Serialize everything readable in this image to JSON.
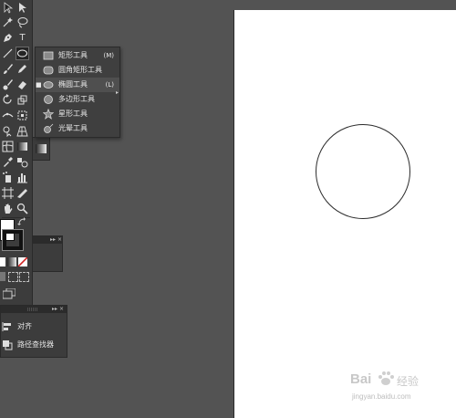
{
  "flyout": {
    "items": [
      {
        "label": "矩形工具",
        "shortcut": "(M)",
        "icon": "rectangle-icon"
      },
      {
        "label": "圆角矩形工具",
        "shortcut": "",
        "icon": "rounded-rectangle-icon"
      },
      {
        "label": "椭圆工具",
        "shortcut": "(L)",
        "icon": "ellipse-icon",
        "selected": true,
        "check": "■"
      },
      {
        "label": "多边形工具",
        "shortcut": "",
        "icon": "polygon-icon"
      },
      {
        "label": "星形工具",
        "shortcut": "",
        "icon": "star-icon"
      },
      {
        "label": "光晕工具",
        "shortcut": "",
        "icon": "flare-icon"
      }
    ],
    "expand_arrow": "▸"
  },
  "minipanel": {
    "controls": "▸▸ ×"
  },
  "align_panel": {
    "controls": "▸▸ ×",
    "items": [
      {
        "label": "对齐",
        "icon": "align-icon"
      },
      {
        "label": "路径查找器",
        "icon": "pathfinder-icon"
      }
    ]
  },
  "toolbar": {
    "type_tool_glyph": "T"
  },
  "watermark": {
    "brand_text": "Bai",
    "brand_suffix": "经验",
    "url": "jingyan.baidu.com"
  },
  "colors": {
    "workspace": "#535353",
    "panel": "#3c3c3c",
    "artboard": "#ffffff"
  }
}
